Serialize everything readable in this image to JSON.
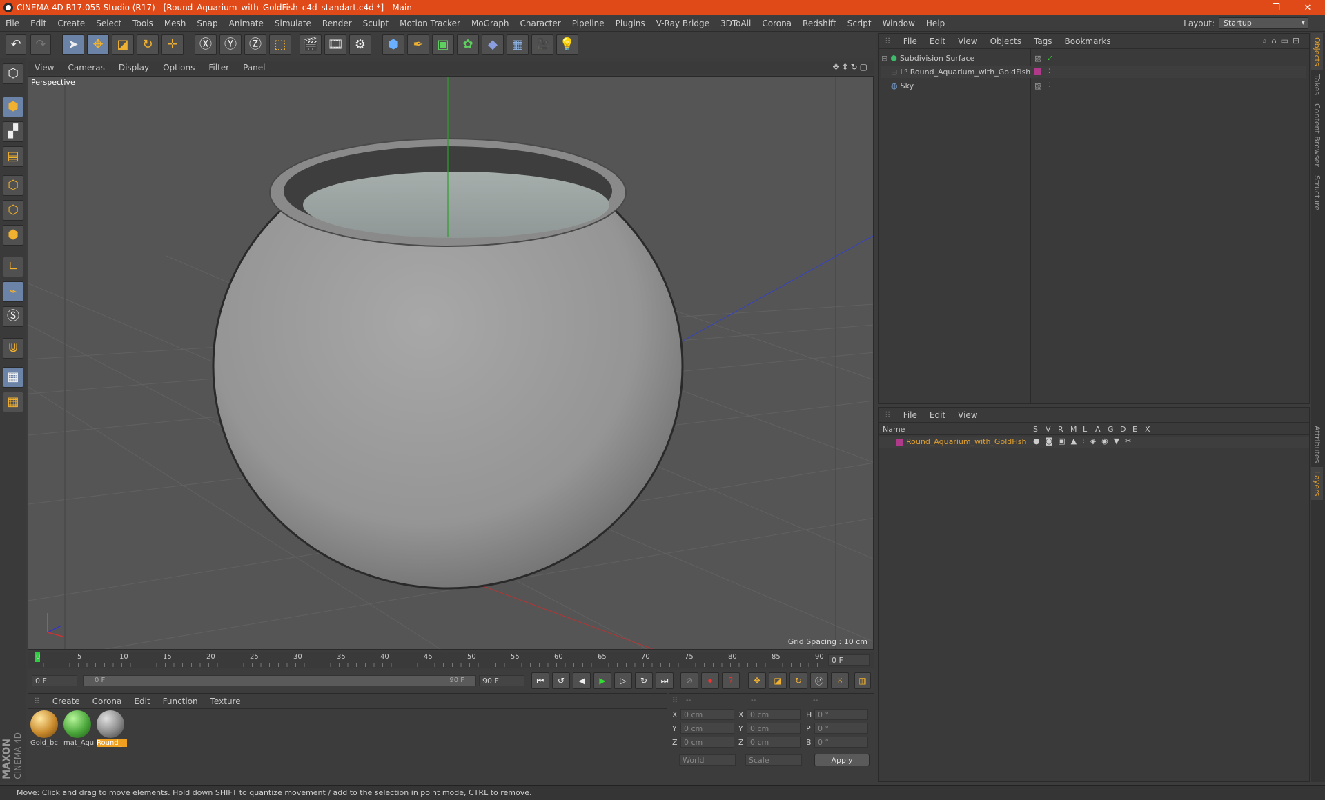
{
  "window": {
    "title": "CINEMA 4D R17.055 Studio (R17) - [Round_Aquarium_with_GoldFish_c4d_standart.c4d *] - Main",
    "min": "–",
    "max": "❐",
    "close": "✕"
  },
  "menu": [
    "File",
    "Edit",
    "Create",
    "Select",
    "Tools",
    "Mesh",
    "Snap",
    "Animate",
    "Simulate",
    "Render",
    "Sculpt",
    "Motion Tracker",
    "MoGraph",
    "Character",
    "Pipeline",
    "Plugins",
    "V-Ray Bridge",
    "3DToAll",
    "Corona",
    "Redshift",
    "Script",
    "Window",
    "Help"
  ],
  "layout": {
    "label": "Layout:",
    "value": "Startup"
  },
  "viewport": {
    "menu": [
      "View",
      "Cameras",
      "Display",
      "Options",
      "Filter",
      "Panel"
    ],
    "label": "Perspective",
    "grid_spacing": "Grid Spacing : 10 cm"
  },
  "timeline": {
    "ticks": [
      "0",
      "5",
      "10",
      "15",
      "20",
      "25",
      "30",
      "35",
      "40",
      "45",
      "50",
      "55",
      "60",
      "65",
      "70",
      "75",
      "80",
      "85",
      "90"
    ],
    "frame": "0 F"
  },
  "transport": {
    "start": "0 F",
    "range_start": "0 F",
    "range_end": "90 F",
    "end": "90 F"
  },
  "materials": {
    "menu": [
      "Create",
      "Corona",
      "Edit",
      "Function",
      "Texture"
    ],
    "items": [
      {
        "name": "Gold_bc",
        "color": "#c98a2c"
      },
      {
        "name": "mat_Aqu",
        "color": "#4aa63a"
      },
      {
        "name": "Round_",
        "color": "#8a8a8a"
      }
    ]
  },
  "coords": {
    "headers": [
      "--",
      "--",
      "--"
    ],
    "rows": [
      {
        "a": "X",
        "av": "0 cm",
        "b": "X",
        "bv": "0 cm",
        "c": "H",
        "cv": "0 °"
      },
      {
        "a": "Y",
        "av": "0 cm",
        "b": "Y",
        "bv": "0 cm",
        "c": "P",
        "cv": "0 °"
      },
      {
        "a": "Z",
        "av": "0 cm",
        "b": "Z",
        "bv": "0 cm",
        "c": "B",
        "cv": "0 °"
      }
    ],
    "world": "World",
    "scale": "Scale",
    "apply": "Apply"
  },
  "objects": {
    "menu": [
      "File",
      "Edit",
      "View",
      "Objects",
      "Tags",
      "Bookmarks"
    ],
    "items": [
      {
        "name": "Subdivision Surface",
        "indent": 0
      },
      {
        "name": "Round_Aquarium_with_GoldFish",
        "indent": 1
      },
      {
        "name": "Sky",
        "indent": 0
      }
    ]
  },
  "layers": {
    "menu": [
      "File",
      "Edit",
      "View"
    ],
    "name_header": "Name",
    "flags": [
      "S",
      "V",
      "R",
      "M",
      "L",
      "A",
      "G",
      "D",
      "E",
      "X"
    ],
    "items": [
      {
        "name": "Round_Aquarium_with_GoldFish",
        "color": "#e0a030"
      }
    ]
  },
  "right_tabs": [
    "Objects",
    "Takes",
    "Content Browser",
    "Structure",
    "Attributes",
    "Layers"
  ],
  "brand": [
    "MAXON",
    "CINEMA 4D"
  ],
  "status": "Move: Click and drag to move elements. Hold down SHIFT to quantize movement / add to the selection in point mode, CTRL to remove."
}
